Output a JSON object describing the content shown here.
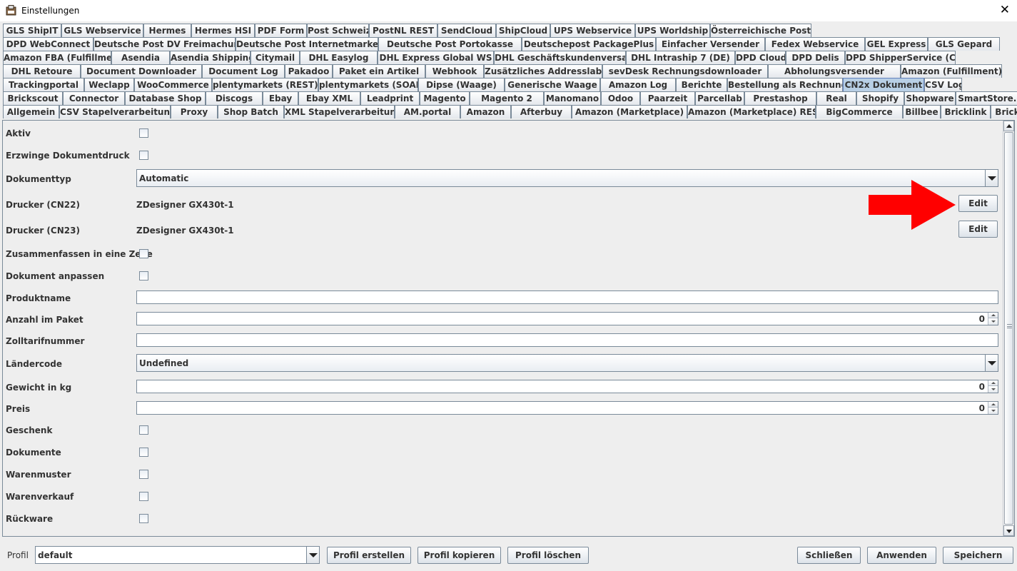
{
  "window": {
    "title": "Einstellungen",
    "close_glyph": "✕",
    "icon": "app-icon"
  },
  "tab_rows": [
    [
      "GLS ShipIT",
      "GLS Webservice",
      "Hermes",
      "Hermes HSI",
      "PDF Form",
      "Post Schweiz",
      "PostNL REST",
      "SendCloud",
      "ShipCloud",
      "UPS Webservice",
      "UPS Worldship",
      "Österreichische Post"
    ],
    [
      "DPD WebConnect",
      "Deutsche Post DV Freimachung",
      "Deutsche Post Internetmarke",
      "Deutsche Post Portokasse",
      "Deutschepost PackagePlus",
      "Einfacher Versender",
      "Fedex Webservice",
      "GEL Express",
      "GLS Gepard"
    ],
    [
      "Amazon FBA (Fulfillment)",
      "Asendia",
      "Asendia Shipping",
      "Citymail",
      "DHL Easylog",
      "DHL Express Global WS",
      "DHL Geschäftskundenversand",
      "DHL Intraship 7 (DE)",
      "DPD Cloud",
      "DPD Delis",
      "DPD ShipperService (CH)"
    ],
    [
      "DHL Retoure",
      "Document Downloader",
      "Document Log",
      "Pakadoo",
      "Paket ein Artikel",
      "Webhook",
      "Zusätzliches Addresslabel",
      "sevDesk Rechnungsdownloader",
      "Abholungsversender",
      "Amazon (Fulfillment)"
    ],
    [
      "Trackingportal",
      "Weclapp",
      "WooCommerce",
      "plentymarkets (REST)",
      "plentymarkets (SOAP)",
      "Dipse (Waage)",
      "Generische Waage",
      "Amazon Log",
      "Berichte",
      "Bestellung als Rechnung",
      "CN2x Dokument",
      "CSV Log"
    ],
    [
      "Brickscout",
      "Connector",
      "Database Shop",
      "Discogs",
      "Ebay",
      "Ebay XML",
      "Leadprint",
      "Magento",
      "Magento 2",
      "Manomano",
      "Odoo",
      "Paarzeit",
      "Parcellab",
      "Prestashop",
      "Real",
      "Shopify",
      "Shopware",
      "SmartStore.NET"
    ],
    [
      "Allgemein",
      "CSV Stapelverarbeitung",
      "Proxy",
      "Shop Batch",
      "XML Stapelverarbeitung",
      "AM.portal",
      "Amazon",
      "Afterbuy",
      "Amazon (Marketplace)",
      "Amazon (Marketplace) REST",
      "BigCommerce",
      "Billbee",
      "Bricklink",
      "Brickowl"
    ]
  ],
  "selected_tab": "CN2x Dokument",
  "form": {
    "aktiv": {
      "label": "Aktiv",
      "checked": false
    },
    "erzwinge": {
      "label": "Erzwinge Dokumentdruck",
      "checked": false
    },
    "dokumenttyp": {
      "label": "Dokumenttyp",
      "value": "Automatic"
    },
    "drucker_cn22": {
      "label": "Drucker (CN22)",
      "value": "ZDesigner GX430t-1",
      "button": "Edit"
    },
    "drucker_cn23": {
      "label": "Drucker (CN23)",
      "value": "ZDesigner GX430t-1",
      "button": "Edit"
    },
    "zusammenfassen": {
      "label": "Zusammenfassen in eine Zeile",
      "checked": false
    },
    "anpassen": {
      "label": "Dokument anpassen",
      "checked": false
    },
    "produktname": {
      "label": "Produktname",
      "value": ""
    },
    "anzahl": {
      "label": "Anzahl im Paket",
      "value": "0"
    },
    "zolltarif": {
      "label": "Zolltarifnummer",
      "value": ""
    },
    "laendercode": {
      "label": "Ländercode",
      "value": "Undefined"
    },
    "gewicht": {
      "label": "Gewicht in kg",
      "value": "0"
    },
    "preis": {
      "label": "Preis",
      "value": "0"
    },
    "geschenk": {
      "label": "Geschenk",
      "checked": false
    },
    "dokumente": {
      "label": "Dokumente",
      "checked": false
    },
    "warenmuster": {
      "label": "Warenmuster",
      "checked": false
    },
    "warenverkauf": {
      "label": "Warenverkauf",
      "checked": false
    },
    "rueckware": {
      "label": "Rückware",
      "checked": false
    }
  },
  "annotation": {
    "arrow_color": "#ff0000",
    "points_to": "edit-cn22-button"
  },
  "footer": {
    "profil_label": "Profil",
    "profil_value": "default",
    "buttons": {
      "erstellen": "Profil erstellen",
      "kopieren": "Profil kopieren",
      "loeschen": "Profil löschen",
      "schliessen": "Schließen",
      "anwenden": "Anwenden",
      "speichern": "Speichern"
    }
  },
  "colors": {
    "selected_tab_bg": "#b8cfe5",
    "panel_bg": "#eeeeee",
    "border": "#7a8a99"
  }
}
